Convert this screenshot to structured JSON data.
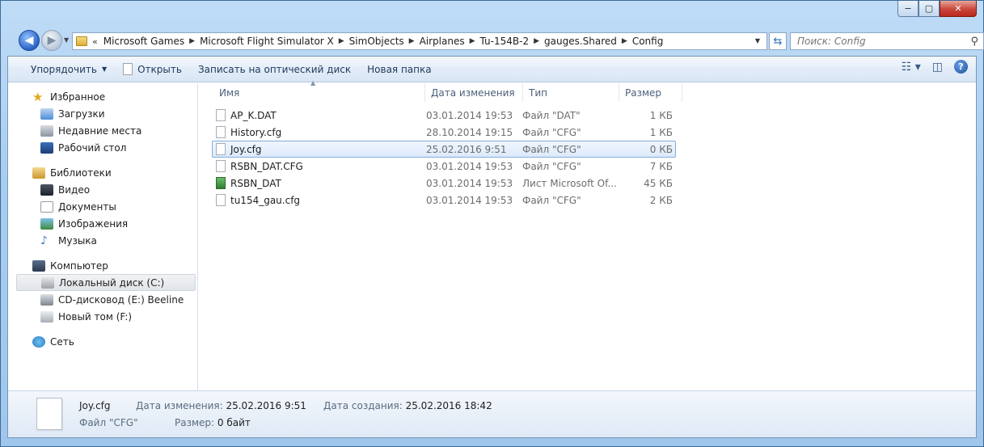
{
  "window": {
    "caption_min": "−",
    "caption_max": "▢",
    "caption_close": "✕"
  },
  "address_bar": {
    "overflow": "«",
    "path": [
      "Microsoft Games",
      "Microsoft Flight Simulator X",
      "SimObjects",
      "Airplanes",
      "Tu-154B-2",
      "gauges.Shared",
      "Config"
    ],
    "separator": "▶"
  },
  "search": {
    "placeholder": "Поиск: Config"
  },
  "toolbar": {
    "organize": "Упорядочить",
    "open": "Открыть",
    "burn": "Записать на оптический диск",
    "new_folder": "Новая папка"
  },
  "navigation": {
    "favorites": {
      "label": "Избранное",
      "items": [
        "Загрузки",
        "Недавние места",
        "Рабочий стол"
      ]
    },
    "libraries": {
      "label": "Библиотеки",
      "items": [
        "Видео",
        "Документы",
        "Изображения",
        "Музыка"
      ]
    },
    "computer": {
      "label": "Компьютер",
      "items": [
        "Локальный диск (C:)",
        "CD-дисковод (E:) Beeline",
        "Новый том (F:)"
      ]
    },
    "network": {
      "label": "Сеть"
    }
  },
  "columns": {
    "name": "Имя",
    "date": "Дата изменения",
    "type": "Тип",
    "size": "Размер"
  },
  "files": [
    {
      "name": "AP_K.DAT",
      "date": "03.01.2014 19:53",
      "type": "Файл \"DAT\"",
      "size": "1 КБ",
      "icon": "file-icon"
    },
    {
      "name": "History.cfg",
      "date": "28.10.2014 19:15",
      "type": "Файл \"CFG\"",
      "size": "1 КБ",
      "icon": "file-icon"
    },
    {
      "name": "Joy.cfg",
      "date": "25.02.2016 9:51",
      "type": "Файл \"CFG\"",
      "size": "0 КБ",
      "icon": "file-icon",
      "selected": true
    },
    {
      "name": "RSBN_DAT.CFG",
      "date": "03.01.2014 19:53",
      "type": "Файл \"CFG\"",
      "size": "7 КБ",
      "icon": "file-icon"
    },
    {
      "name": "RSBN_DAT",
      "date": "03.01.2014 19:53",
      "type": "Лист Microsoft Of...",
      "size": "45 КБ",
      "icon": "excel-icon"
    },
    {
      "name": "tu154_gau.cfg",
      "date": "03.01.2014 19:53",
      "type": "Файл \"CFG\"",
      "size": "2 КБ",
      "icon": "file-icon"
    }
  ],
  "details": {
    "name": "Joy.cfg",
    "type": "Файл \"CFG\"",
    "modified_label": "Дата изменения:",
    "modified": "25.02.2016 9:51",
    "created_label": "Дата создания:",
    "created": "25.02.2016 18:42",
    "size_label": "Размер:",
    "size": "0 байт"
  }
}
